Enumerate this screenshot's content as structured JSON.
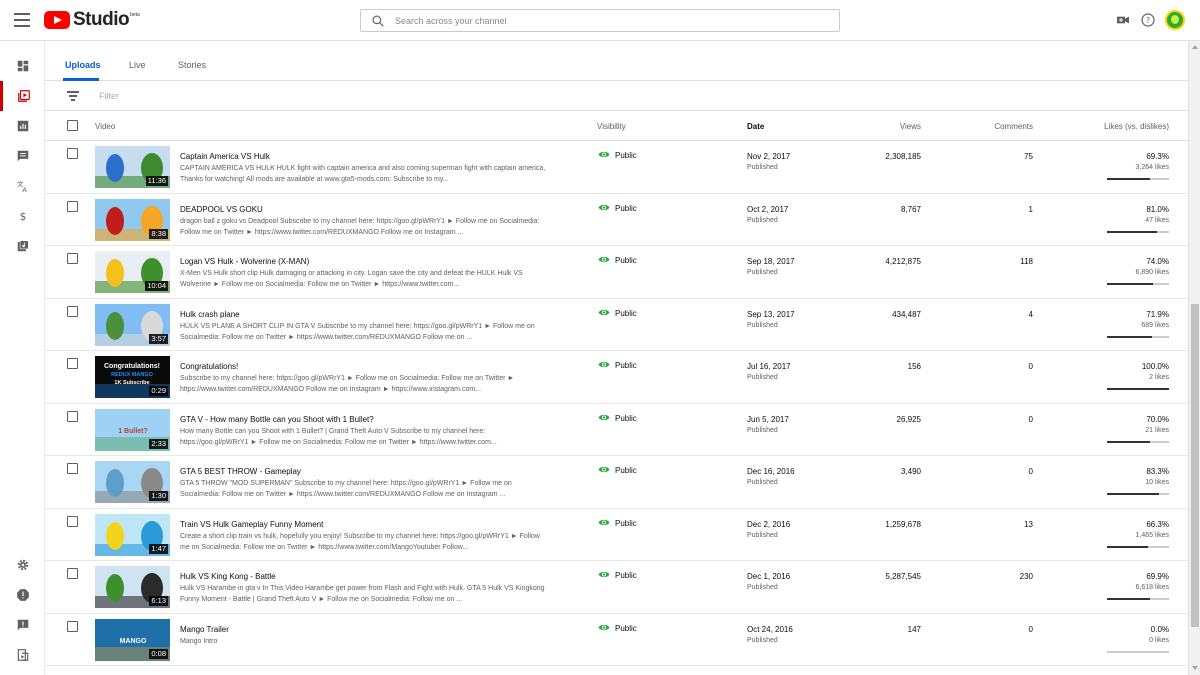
{
  "app": {
    "logo_text": "Studio",
    "logo_badge": "beta"
  },
  "search": {
    "placeholder": "Search across your channel"
  },
  "topbar_icons": [
    "video-camera-icon",
    "help-icon"
  ],
  "sidebar": {
    "items": [
      {
        "icon": "dashboard-icon"
      },
      {
        "icon": "videos-icon",
        "active": true
      },
      {
        "icon": "analytics-icon"
      },
      {
        "icon": "comments-icon"
      },
      {
        "icon": "translations-icon"
      },
      {
        "icon": "monetization-icon"
      },
      {
        "icon": "audio-library-icon"
      }
    ],
    "bottom_items": [
      {
        "icon": "settings-icon"
      },
      {
        "icon": "feedback-alert-icon"
      },
      {
        "icon": "send-feedback-icon"
      },
      {
        "icon": "creator-studio-classic-icon"
      }
    ]
  },
  "tabs": [
    {
      "label": "Uploads",
      "active": true
    },
    {
      "label": "Live"
    },
    {
      "label": "Stories"
    }
  ],
  "filter": {
    "placeholder": "Filter"
  },
  "columns": {
    "video": "Video",
    "visibility": "Visibility",
    "date": "Date",
    "views": "Views",
    "comments": "Comments",
    "likes": "Likes (vs. dislikes)"
  },
  "colors": {
    "accent": "#065fd4",
    "brand": "#ff0000",
    "public_icon": "#2ba640"
  },
  "videos": [
    {
      "title": "Captain America VS Hulk",
      "description": "CAPTAIN AMERICA VS HULK HULK fight with captain america and also coming superman fight with captain america, Thanks for watching! All mods are available at www.gta5-mods.com: Subscribe to my...",
      "duration": "11:36",
      "visibility": "Public",
      "date": "Nov 2, 2017",
      "status": "Published",
      "views": "2,308,185",
      "comments": "75",
      "likes_pct": "69.3%",
      "likes": "3,264 likes",
      "ratio": 0.693,
      "thumb_colors": [
        "#c6dcef",
        "#2a6fc9",
        "#3d8b2e"
      ]
    },
    {
      "title": "DEADPOOL VS GOKU",
      "description": "dragon ball z goku vs Deadpool Subscribe to my channel here: https://goo.gl/pWRrY1 ► Follow me on Socialmedia: Follow me on Twitter ► https://www.twitter.com/REDUXMANGO Follow me on Instagram ...",
      "duration": "8:38",
      "visibility": "Public",
      "date": "Oct 2, 2017",
      "status": "Published",
      "views": "8,767",
      "comments": "1",
      "likes_pct": "81.0%",
      "likes": "47 likes",
      "ratio": 0.81,
      "thumb_colors": [
        "#8fc9f0",
        "#c21d1d",
        "#f5a623"
      ]
    },
    {
      "title": "Logan VS Hulk - Wolverine (X-MAN)",
      "description": "X-Men VS Hulk short clip Hulk damaging or attacking in city. Logan save the city and defeat the HULK Hulk VS Wolverine ► Follow me on Socialmedia: Follow me on Twitter ► https://www.twitter.com...",
      "duration": "10:04",
      "visibility": "Public",
      "date": "Sep 18, 2017",
      "status": "Published",
      "views": "4,212,875",
      "comments": "118",
      "likes_pct": "74.0%",
      "likes": "6,890 likes",
      "ratio": 0.74,
      "thumb_colors": [
        "#e8eef3",
        "#f2c21b",
        "#3f8f2a"
      ]
    },
    {
      "title": "Hulk crash plane",
      "description": "HULK VS PLANE A SHORT CLIP IN GTA V Subscribe to my channel here: https://goo.gl/pWRrY1 ► Follow me on Socialmedia: Follow me on Twitter ► https://www.twitter.com/REDUXMANGO Follow me on ...",
      "duration": "3:57",
      "visibility": "Public",
      "date": "Sep 13, 2017",
      "status": "Published",
      "views": "434,487",
      "comments": "4",
      "likes_pct": "71.9%",
      "likes": "689 likes",
      "ratio": 0.719,
      "thumb_colors": [
        "#7fbdf2",
        "#4c8f3a",
        "#d9d9d9"
      ]
    },
    {
      "title": "Congratulations!",
      "description": "Subscribe to my channel here: https://goo.gl/pWRrY1 ► Follow me on Socialmedia: Follow me on Twitter ► https://www.twitter.com/REDUXMANGO Follow me on Instagram ► https://www.instagram.com...",
      "duration": "0:29",
      "visibility": "Public",
      "date": "Jul 16, 2017",
      "status": "Published",
      "views": "156",
      "comments": "0",
      "likes_pct": "100.0%",
      "likes": "2 likes",
      "ratio": 1.0,
      "thumb_colors": [
        "#0a0a0a",
        "#1e90ff",
        "#ffffff"
      ],
      "thumb_text": [
        "Congratulations!",
        "REDUX MANGO",
        "1K Subscribe"
      ]
    },
    {
      "title": "GTA V - How many Bottle can you Shoot with 1 Bullet?",
      "description": "How many Bottle can you Shoot with 1 Bullet? | Grand Theft Auto V Subscribe to my channel here: https://goo.gl/pWRrY1 ► Follow me on Socialmedia: Follow me on Twitter ► https://www.twitter.com...",
      "duration": "2:33",
      "visibility": "Public",
      "date": "Jun 5, 2017",
      "status": "Published",
      "views": "26,925",
      "comments": "0",
      "likes_pct": "70.0%",
      "likes": "21 likes",
      "ratio": 0.7,
      "thumb_colors": [
        "#9fd0f5",
        "#3a9a3a",
        "#b5462b"
      ],
      "thumb_text": [
        "1 Bullet?"
      ]
    },
    {
      "title": "GTA 5 BEST THROW - Gameplay",
      "description": "GTA 5 THROW \"MOD SUPERMAN\" Subscribe to my channel here: https://goo.gl/pWRrY1 ► Follow me on Socialmedia: Follow me on Twitter ► https://www.twitter.com/REDUXMANGO Follow me on Instagram ...",
      "duration": "1:30",
      "visibility": "Public",
      "date": "Dec 16, 2016",
      "status": "Published",
      "views": "3,490",
      "comments": "0",
      "likes_pct": "83.3%",
      "likes": "10 likes",
      "ratio": 0.833,
      "thumb_colors": [
        "#a9d6f2",
        "#5e9ec9",
        "#8a8a8a"
      ]
    },
    {
      "title": "Train VS Hulk Gameplay Funny Moment",
      "description": "Create a short clip train vs hulk, hopefully you enjoy! Subscribe to my channel here: https://goo.gl/pWRrY1 ► Follow me on Socialmedia: Follow me on Twitter ► https://www.twitter.com/MangoYoutuber Follow...",
      "duration": "1:47",
      "visibility": "Public",
      "date": "Dec 2, 2016",
      "status": "Published",
      "views": "1,259,678",
      "comments": "13",
      "likes_pct": "66.3%",
      "likes": "1,465 likes",
      "ratio": 0.663,
      "thumb_colors": [
        "#bfe6f7",
        "#f2d21b",
        "#2a9ad9"
      ]
    },
    {
      "title": "Hulk VS King Kong - Battle",
      "description": "Hulk VS Harambe in gta v In This Video Harambe get power from Flash and Fight with Hulk. GTA 5 Hulk VS Kingkong Funny Moment - Battle | Grand Theft Auto V ► Follow me on Socialmedia: Follow me on ...",
      "duration": "6:13",
      "visibility": "Public",
      "date": "Dec 1, 2016",
      "status": "Published",
      "views": "5,287,545",
      "comments": "230",
      "likes_pct": "69.9%",
      "likes": "6,618 likes",
      "ratio": 0.699,
      "thumb_colors": [
        "#cfe3f0",
        "#3e8f2e",
        "#2b2b2b"
      ]
    },
    {
      "title": "Mango Trailer",
      "description": "Mango Intro",
      "duration": "0:08",
      "visibility": "Public",
      "date": "Oct 24, 2016",
      "status": "Published",
      "views": "147",
      "comments": "0",
      "likes_pct": "0.0%",
      "likes": "0 likes",
      "ratio": 0.0,
      "thumb_colors": [
        "#1f6fa8",
        "#f5a623",
        "#ffffff"
      ],
      "thumb_text": [
        "MANGO"
      ]
    }
  ]
}
